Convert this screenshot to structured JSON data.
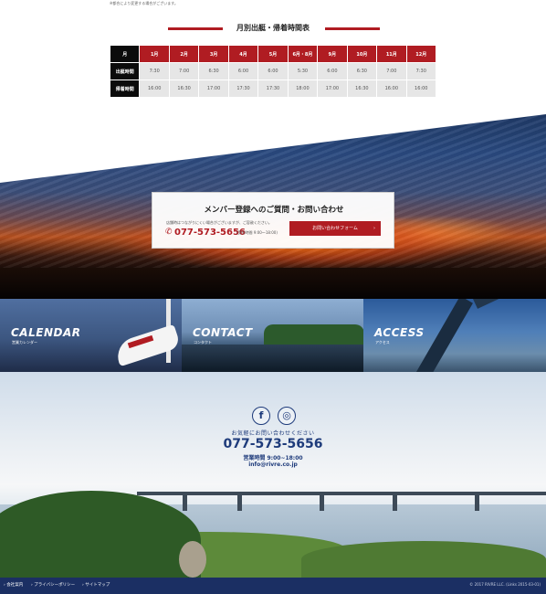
{
  "topnote": "※都合により変更する場合がございます。",
  "schedule": {
    "title": "月別出艇・帰着時間表",
    "corner": "月",
    "months": [
      "1月",
      "2月",
      "3月",
      "4月",
      "5月",
      "6月・8月",
      "9月",
      "10月",
      "11月",
      "12月"
    ],
    "rows": [
      {
        "label": "出艇時間",
        "values": [
          "7:30",
          "7:00",
          "6:30",
          "6:00",
          "6:00",
          "5:30",
          "6:00",
          "6:30",
          "7:00",
          "7:30"
        ]
      },
      {
        "label": "帰着時間",
        "values": [
          "16:00",
          "16:30",
          "17:00",
          "17:30",
          "17:30",
          "18:00",
          "17:00",
          "16:30",
          "16:00",
          "16:00"
        ]
      }
    ]
  },
  "contact_box": {
    "title": "メンバー登録へのご質問・お問い合わせ",
    "note": "店舗時はつながりにくい場合がございますが、ご容赦ください。",
    "phone": "077-573-5656",
    "hours": "(受付時間 9:00～18:00)",
    "button": "お問い合わせフォーム",
    "button_arrow": "›"
  },
  "tiles": [
    {
      "title": "CALENDAR",
      "sub": "営業カレンダー"
    },
    {
      "title": "CONTACT",
      "sub": "コンタクト"
    },
    {
      "title": "ACCESS",
      "sub": "アクセス"
    }
  ],
  "footer_hero": {
    "fb_icon": "f",
    "ig_icon": "◎",
    "lead": "お気軽にお問い合わせください",
    "phone": "077-573-5656",
    "hours": "営業時間 9:00~18:00",
    "email": "info@rivre.co.jp"
  },
  "footer": {
    "links": [
      "› 会社案内",
      "› プライバシーポリシー",
      "› サイトマップ"
    ],
    "copyright": "© 2017 RIVRE LLC. (Links 2015-03-01)"
  },
  "colors": {
    "accent": "#b01c22",
    "navy": "#1b2f63",
    "text_blue": "#1e3b7b"
  }
}
